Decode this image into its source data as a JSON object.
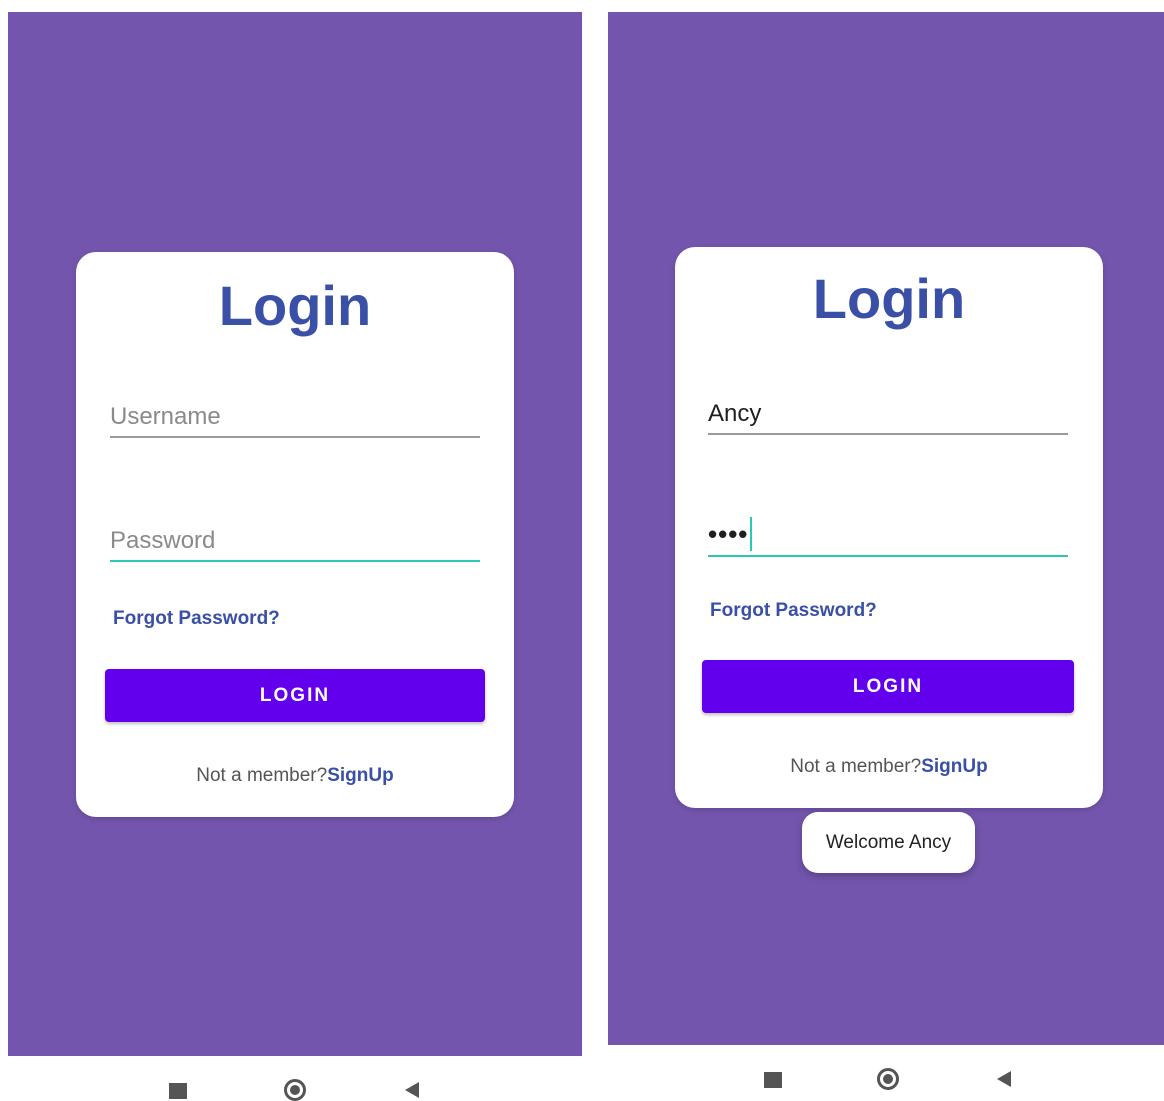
{
  "screens": [
    {
      "title": "Login",
      "username": {
        "value": "",
        "placeholder": "Username"
      },
      "password": {
        "value": "",
        "placeholder": "Password"
      },
      "forgot_label": "Forgot Password?",
      "login_label": "LOGIN",
      "signup_prompt": "Not a member?",
      "signup_label": "SignUp"
    },
    {
      "title": "Login",
      "username": {
        "value": "Ancy",
        "placeholder": ""
      },
      "password": {
        "value": "••••",
        "placeholder": ""
      },
      "forgot_label": "Forgot Password?",
      "login_label": "LOGIN",
      "signup_prompt": "Not a member?",
      "signup_label": "SignUp",
      "toast": "Welcome Ancy"
    }
  ],
  "navigation_bar": {
    "icons": [
      "recents-icon",
      "home-icon",
      "back-icon"
    ]
  },
  "colors": {
    "background": "#7455ad",
    "accent_text": "#3a4fa6",
    "button": "#6200ee",
    "focus_underline": "#2bc8b6"
  }
}
